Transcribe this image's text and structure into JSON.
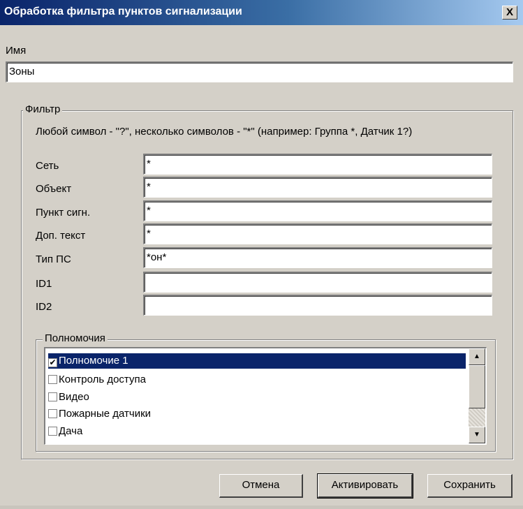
{
  "dialog": {
    "title": "Обработка фильтра пунктов сигнализации",
    "close_glyph": "X"
  },
  "name_section": {
    "label": "Имя",
    "value": "Зоны"
  },
  "filter": {
    "legend": "Фильтр",
    "hint": "Любой символ - \"?\", несколько символов - \"*\" (например: Группа *, Датчик 1?)",
    "fields": [
      {
        "label": "Сеть",
        "value": "*"
      },
      {
        "label": "Объект",
        "value": "*"
      },
      {
        "label": "Пункт сигн.",
        "value": "*"
      },
      {
        "label": "Доп. текст",
        "value": "*"
      },
      {
        "label": "Тип ПС",
        "value": "*он*"
      },
      {
        "label": "ID1",
        "value": ""
      },
      {
        "label": "ID2",
        "value": ""
      }
    ]
  },
  "permissions": {
    "legend": "Полномочия",
    "items": [
      {
        "label": "Полномочие 1",
        "checked": true,
        "selected": true
      },
      {
        "label": "Контроль доступа",
        "checked": false,
        "selected": false
      },
      {
        "label": "Видео",
        "checked": false,
        "selected": false
      },
      {
        "label": "Пожарные датчики",
        "checked": false,
        "selected": false
      },
      {
        "label": "Дача",
        "checked": false,
        "selected": false
      }
    ],
    "check_glyph": "✔",
    "scroll_up_icon": "▲",
    "scroll_down_icon": "▼"
  },
  "buttons": {
    "cancel": "Отмена",
    "activate": "Активировать",
    "save": "Сохранить"
  }
}
